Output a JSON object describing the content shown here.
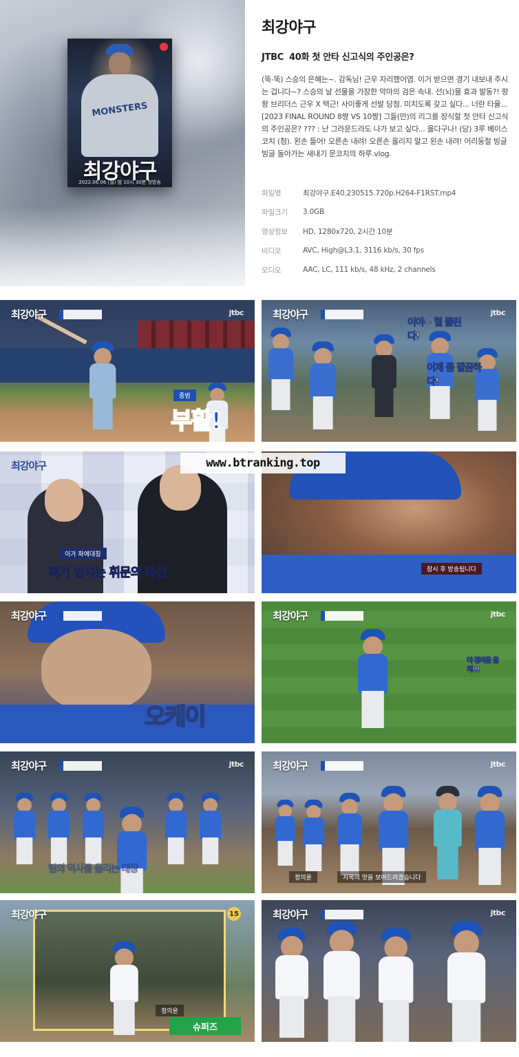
{
  "header": {
    "title": "최강야구",
    "network": "JTBC",
    "episode": "40화 첫 안타 신고식의 주인공은?",
    "description": "(뚝-뚝) 스승의 은혜는~. 감독님! 근우 자리했어염. 이거 받으면 경기 내보내 주시는 겁니다~? 스승의 날 선물을 가장한 악마의 검은 속내. 선(뇌)물 효과 발동?! 팡팡 브리더스 근우 X 택근! 사이좋게 선발 당첨. 미치도록 갖고 싶다... 너란 타율... [2023 FINAL ROUND 8짱 VS 10짱] 그들(만)의 리그를 장식할 첫 안타 신고식의 주인공은? ??? : 난 그라운드라도 나가 보고 싶다... 옳다구나! (당) 3루 베이스코치 (첨). 왼손 들어! 오른손 내려! 오른손 올리지 말고 왼손 내려! 어리둥절 빙글빙글 돌아가는 새내기 문코치의 하루.vlog."
  },
  "poster": {
    "title": "최강야구",
    "date": "2022.06.06 (월) 밤 10시 30분 첫방송",
    "jersey_text": "MONSTERS"
  },
  "meta": [
    {
      "key": "파일명",
      "value": "최강야구.E40.230515.720p.H264-F1RST.mp4"
    },
    {
      "key": "파일크기",
      "value": "3.0GB"
    },
    {
      "key": "영상정보",
      "value": "HD, 1280x720, 2시간 10분"
    },
    {
      "key": "비디오",
      "value": "AVC, High@L3.1, 3116 kb/s, 30 fps"
    },
    {
      "key": "오디오",
      "value": "AAC, LC, 111 kb/s, 48 kHz, 2 channels"
    }
  ],
  "watermark": "www.btranking.top",
  "thumbs": {
    "common_logo": "최강야구",
    "common_net": "jtbc",
    "t1_caption": "부활!",
    "t1_tag": "종범",
    "t2_caption1": "이야~ 혈 뚫린다!",
    "t2_caption2": "이제 좀 깔끔하다!",
    "t3_tag": "이가 좌에대칭",
    "t3_caption": "패기 넘치는 휘문의 타선",
    "t4_caption": "잠시 후 방송됩니다",
    "t5_caption": "오케이",
    "t6_caption": "야 정의윤 올 체!!!",
    "t7_caption": "팀의 역사를 올리는 대장",
    "t8_caption1": "정의윤",
    "t8_caption2": "지목의 맛을 보여드려겠습니다",
    "t9_badge": "15",
    "t9_banner": "슈퍼즈",
    "t9_tag": "정의윤"
  },
  "colors": {
    "jersey_blue": "#2355c9",
    "field_green": "#4f8b3a"
  }
}
